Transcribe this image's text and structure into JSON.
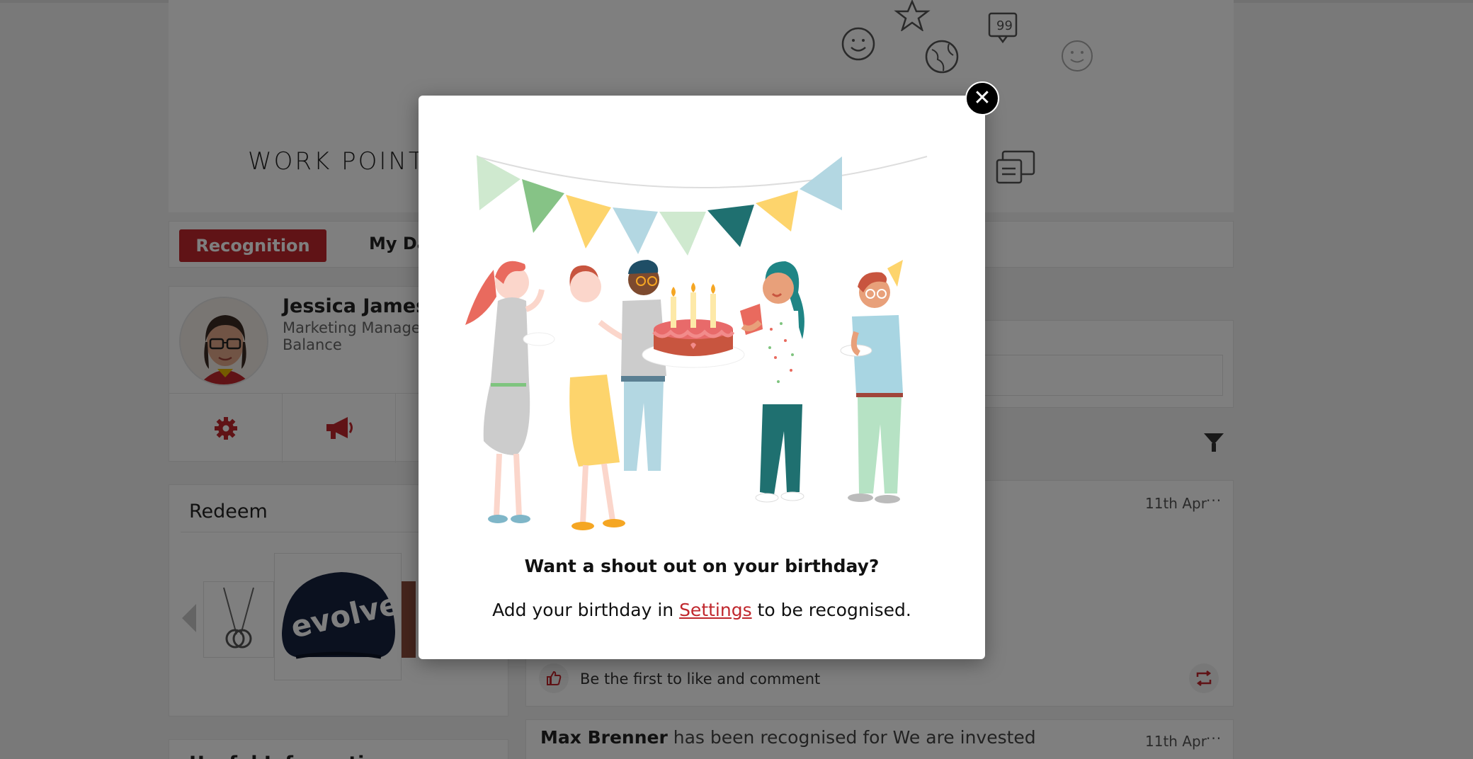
{
  "header": {
    "logo_text": "WORK POINTS"
  },
  "tabs": {
    "active_label": "Recognition",
    "second_label": "My Da"
  },
  "profile": {
    "name": "Jessica James",
    "role": "Marketing Manage",
    "balance_label": "Balance"
  },
  "redeem": {
    "title": "Redeem",
    "helmet_brand": "evolve"
  },
  "lower_panel": {
    "title_partial": "Useful Information"
  },
  "feed": [
    {
      "date": "11th Apr",
      "like_prompt": "Be the first to like and comment"
    },
    {
      "name": "Max Brenner",
      "text": "has been recognised for We are invested",
      "date": "11th Apr"
    }
  ],
  "modal": {
    "close_glyph": "✕",
    "title": "Want a shout out on your birthday?",
    "text_before": "Add your birthday in ",
    "link_text": "Settings",
    "text_after": " to be recognised."
  },
  "colors": {
    "brand_red": "#c0272d",
    "overlay": "rgba(0,0,0,0.5)"
  },
  "icons": [
    "gear-icon",
    "megaphone-icon",
    "filter-icon",
    "thumbs-up-icon",
    "repost-icon",
    "close-icon",
    "star-icon",
    "smiley-icon",
    "globe-icon",
    "quote-bubble-icon",
    "chat-icon"
  ]
}
